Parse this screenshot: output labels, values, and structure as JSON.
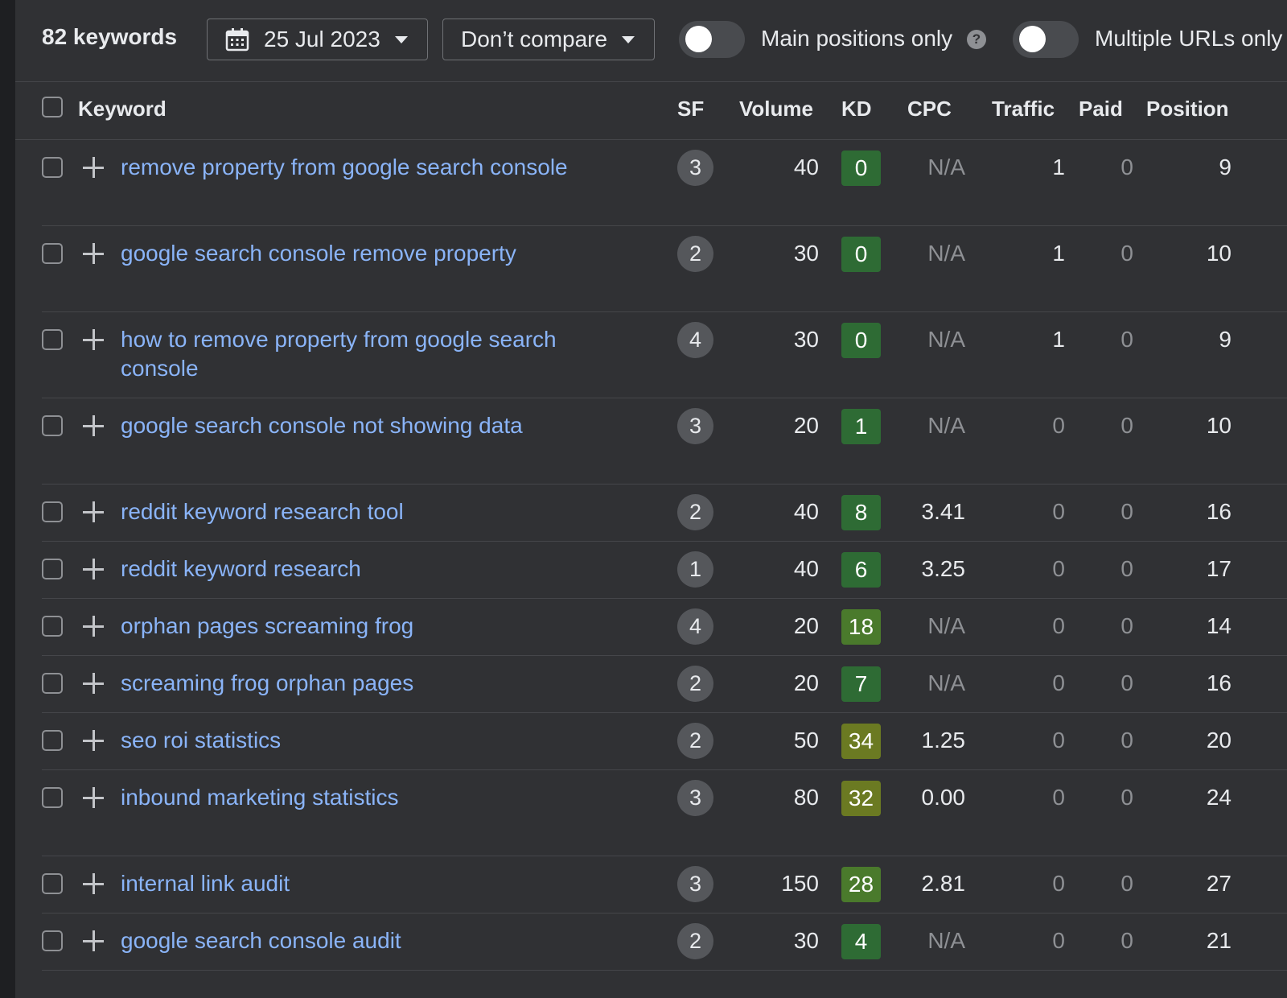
{
  "toolbar": {
    "keyword_count": "82 keywords",
    "date": "25 Jul 2023",
    "compare": "Don’t compare",
    "main_positions_label": "Main positions only",
    "multiple_urls_label": "Multiple URLs only",
    "help_glyph": "?",
    "main_positions_on": false,
    "multiple_urls_on": false
  },
  "columns": {
    "keyword": "Keyword",
    "sf": "SF",
    "volume": "Volume",
    "kd": "KD",
    "cpc": "CPC",
    "traffic": "Traffic",
    "paid": "Paid",
    "position": "Position"
  },
  "kd_colors": {
    "easy": "#2e6b34",
    "medium": "#4a7a2c",
    "hard": "#6b7a22"
  },
  "rows": [
    {
      "keyword": "remove property from google search console",
      "sf": "3",
      "volume": "40",
      "kd": "0",
      "kd_level": "easy",
      "cpc": "N/A",
      "traffic": "1",
      "paid": "0",
      "position": "9"
    },
    {
      "keyword": "google search console remove property",
      "sf": "2",
      "volume": "30",
      "kd": "0",
      "kd_level": "easy",
      "cpc": "N/A",
      "traffic": "1",
      "paid": "0",
      "position": "10"
    },
    {
      "keyword": "how to remove property from google search console",
      "sf": "4",
      "volume": "30",
      "kd": "0",
      "kd_level": "easy",
      "cpc": "N/A",
      "traffic": "1",
      "paid": "0",
      "position": "9"
    },
    {
      "keyword": "google search console not showing data",
      "sf": "3",
      "volume": "20",
      "kd": "1",
      "kd_level": "easy",
      "cpc": "N/A",
      "traffic": "0",
      "paid": "0",
      "position": "10"
    },
    {
      "keyword": "reddit keyword research tool",
      "sf": "2",
      "volume": "40",
      "kd": "8",
      "kd_level": "easy",
      "cpc": "3.41",
      "traffic": "0",
      "paid": "0",
      "position": "16"
    },
    {
      "keyword": "reddit keyword research",
      "sf": "1",
      "volume": "40",
      "kd": "6",
      "kd_level": "easy",
      "cpc": "3.25",
      "traffic": "0",
      "paid": "0",
      "position": "17"
    },
    {
      "keyword": "orphan pages screaming frog",
      "sf": "4",
      "volume": "20",
      "kd": "18",
      "kd_level": "medium",
      "cpc": "N/A",
      "traffic": "0",
      "paid": "0",
      "position": "14"
    },
    {
      "keyword": "screaming frog orphan pages",
      "sf": "2",
      "volume": "20",
      "kd": "7",
      "kd_level": "easy",
      "cpc": "N/A",
      "traffic": "0",
      "paid": "0",
      "position": "16"
    },
    {
      "keyword": "seo roi statistics",
      "sf": "2",
      "volume": "50",
      "kd": "34",
      "kd_level": "hard",
      "cpc": "1.25",
      "traffic": "0",
      "paid": "0",
      "position": "20"
    },
    {
      "keyword": "inbound marketing statistics",
      "sf": "3",
      "volume": "80",
      "kd": "32",
      "kd_level": "hard",
      "cpc": "0.00",
      "traffic": "0",
      "paid": "0",
      "position": "24"
    },
    {
      "keyword": "internal link audit",
      "sf": "3",
      "volume": "150",
      "kd": "28",
      "kd_level": "medium",
      "cpc": "2.81",
      "traffic": "0",
      "paid": "0",
      "position": "27"
    },
    {
      "keyword": "google search console audit",
      "sf": "2",
      "volume": "30",
      "kd": "4",
      "kd_level": "easy",
      "cpc": "N/A",
      "traffic": "0",
      "paid": "0",
      "position": "21"
    }
  ]
}
